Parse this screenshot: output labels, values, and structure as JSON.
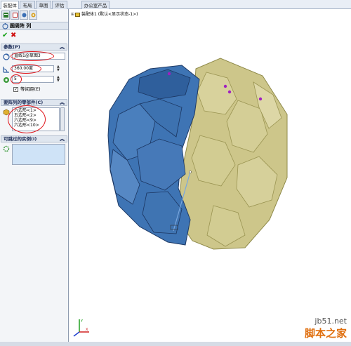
{
  "tabs": [
    {
      "label": "装配体",
      "active": true
    },
    {
      "label": "布局",
      "active": false
    },
    {
      "label": "草图",
      "active": false
    },
    {
      "label": "评估",
      "active": false
    },
    {
      "label": "办公室产品",
      "active": false
    }
  ],
  "panel_tab_icons": [
    "feature-manager-icon",
    "property-manager-icon",
    "configuration-manager-icon",
    "appearance-icon"
  ],
  "feature": {
    "title": "圆周阵 列",
    "ok_icon": "checkmark-icon",
    "cancel_icon": "cross-icon"
  },
  "params": {
    "header": "参数(P)",
    "axis_value": "直线1@草图3",
    "angle_value": "360.00度",
    "count_value": "5",
    "equal_spacing_label": "等间距(E)",
    "equal_spacing_checked": true
  },
  "components": {
    "header": "要阵列的零部件(C)",
    "items": [
      "六边形<1>",
      "五边形<2>",
      "六边形<9>",
      "六边形<10>"
    ]
  },
  "skip": {
    "header": "可跳过的实例(I)"
  },
  "viewport": {
    "tree_label": "装配体1 (默认<显示状态-1>)"
  },
  "watermark": {
    "url": "jb51.net",
    "name": "脚本之家"
  },
  "colors": {
    "blue_face": "#3e74b4",
    "yellow_face": "#cfc888",
    "accent_red": "#e0141a"
  }
}
